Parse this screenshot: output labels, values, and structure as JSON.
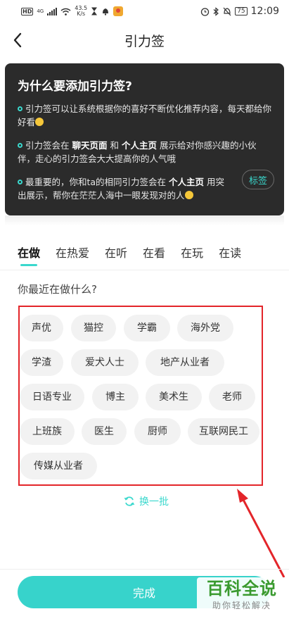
{
  "status_bar": {
    "hd": "HD",
    "network": "4G",
    "speed": "43.5\nK/s",
    "battery": "75",
    "time": "12:09"
  },
  "nav": {
    "title": "引力签"
  },
  "info_card": {
    "title": "为什么要添加引力签?",
    "item1": "引力签可以让系统根据你的喜好不断优化推荐内容，每天都给你好看",
    "item2_a": "引力签会在 ",
    "item2_b1": "聊天页面",
    "item2_c": " 和 ",
    "item2_b2": "个人主页",
    "item2_d": " 展示给对你感兴趣的小伙伴，走心的引力签会大大提高你的人气哦",
    "item3_a": "最重要的，你和ta的相同引力签会在 ",
    "item3_b": "个人主页",
    "item3_c": " 用突出展示，帮你在茫茫人海中一眼发现对的人",
    "tag_badge": "标签"
  },
  "tabs": [
    "在做",
    "在热爱",
    "在听",
    "在看",
    "在玩",
    "在读"
  ],
  "active_tab": 0,
  "question": "你最近在做什么?",
  "chips": [
    "声优",
    "猫控",
    "学霸",
    "海外党",
    "学渣",
    "爱犬人士",
    "地产从业者",
    "日语专业",
    "博主",
    "美术生",
    "老师",
    "上班族",
    "医生",
    "厨师",
    "互联网民工",
    "传媒从业者"
  ],
  "refresh_label": "换一批",
  "done_label": "完成",
  "watermark": {
    "title": "百科全说",
    "subtitle": "助你轻松解决"
  },
  "colors": {
    "accent": "#37d3cb",
    "card_bg": "#2b2b2b",
    "highlight": "#e3252a"
  }
}
